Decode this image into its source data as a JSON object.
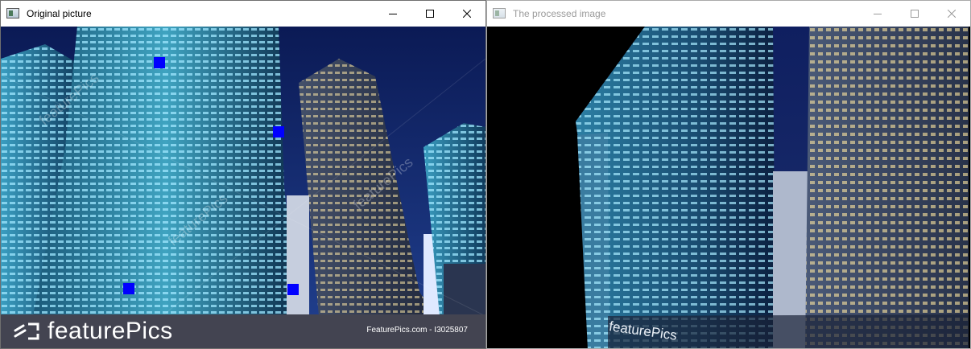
{
  "windows": [
    {
      "title": "Original picture",
      "active": true,
      "controls": [
        "minimize-icon",
        "maximize-icon",
        "close-icon"
      ]
    },
    {
      "title": "The processed image",
      "active": false,
      "controls": [
        "minimize-icon",
        "maximize-icon",
        "close-icon"
      ]
    }
  ],
  "original": {
    "watermark_text": "featurePics",
    "banner": {
      "brand": "featurePics",
      "credit": "FeaturePics.com - I3025807",
      "background": "#434451"
    },
    "marker_color": "#0000ff",
    "marker_count": 4
  },
  "processed": {
    "brand": "featurePics",
    "background": "#000000"
  }
}
